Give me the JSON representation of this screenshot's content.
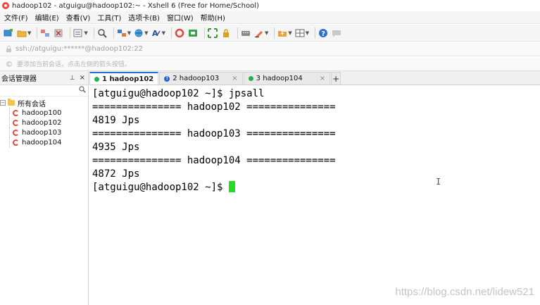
{
  "window": {
    "title": "hadoop102 - atguigu@hadoop102:~ - Xshell 6 (Free for Home/School)"
  },
  "menu": [
    "文件(F)",
    "编辑(E)",
    "查看(V)",
    "工具(T)",
    "选项卡(B)",
    "窗口(W)",
    "帮助(H)"
  ],
  "address": {
    "text": "ssh://atguigu:******@hadoop102:22"
  },
  "hint": {
    "text": "要添加当前会话，点击左侧的箭头按钮。"
  },
  "session_manager": {
    "title": "会话管理器",
    "pin_glyph": "⊥",
    "close_glyph": "×",
    "root_label": "所有会话",
    "toggle_glyph": "−",
    "items": [
      {
        "label": "hadoop100"
      },
      {
        "label": "hadoop102"
      },
      {
        "label": "hadoop103"
      },
      {
        "label": "hadoop104"
      }
    ]
  },
  "tabs": [
    {
      "label": "1 hadoop102",
      "status": "connected",
      "active": true
    },
    {
      "label": "2 hadoop103",
      "status": "info",
      "active": false
    },
    {
      "label": "3 hadoop104",
      "status": "connected",
      "active": false
    }
  ],
  "tab_close_glyph": "×",
  "tab_add_glyph": "+",
  "terminal": {
    "lines": [
      "[atguigu@hadoop102 ~]$ jpsall",
      "=============== hadoop102 ===============",
      "4819 Jps",
      "=============== hadoop103 ===============",
      "4935 Jps",
      "=============== hadoop104 ===============",
      "4872 Jps"
    ],
    "prompt": "[atguigu@hadoop102 ~]$ ",
    "cursor_color": "#22dd22"
  },
  "watermark": "https://blog.csdn.net/lidew521",
  "colors": {
    "accent": "#2b6fd6",
    "connected": "#22b14c",
    "session_icon": "#e04a3a"
  }
}
